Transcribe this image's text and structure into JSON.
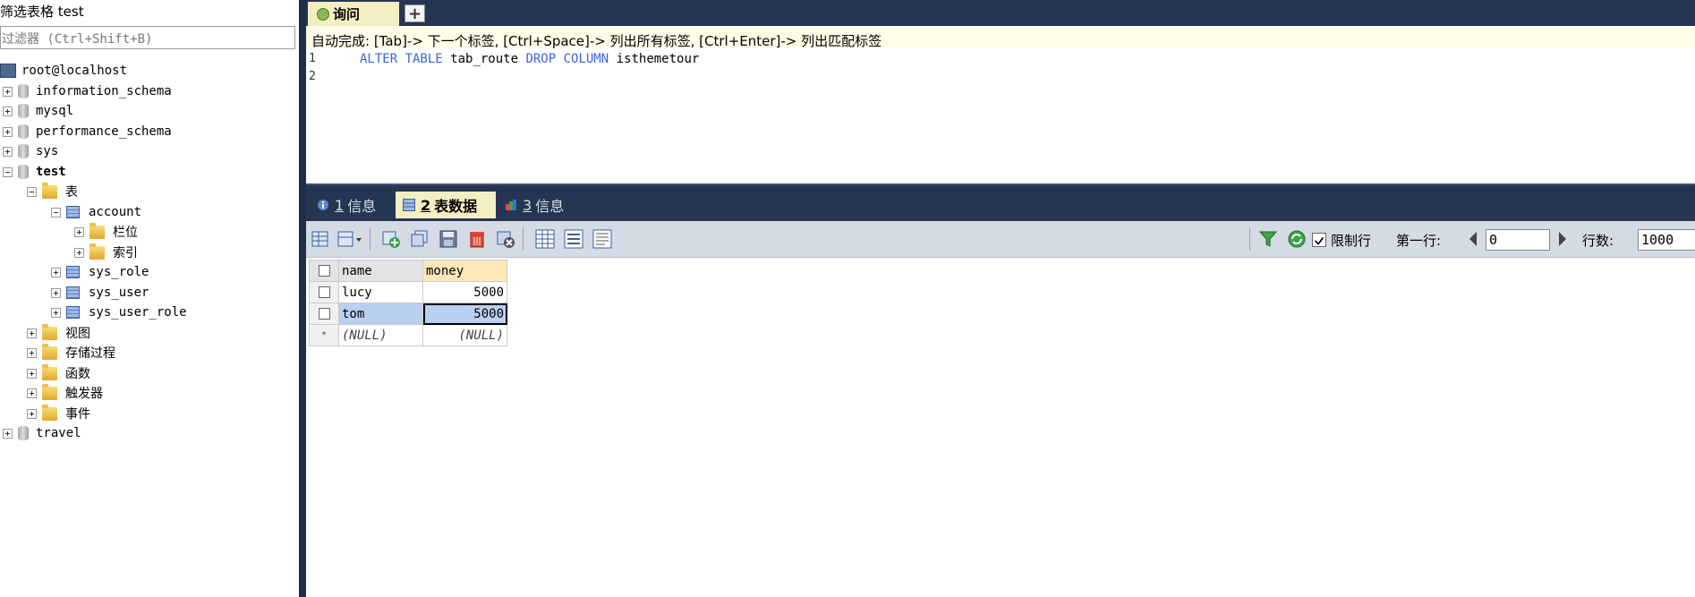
{
  "left": {
    "title": "筛选表格 test",
    "filter_placeholder": "过滤器 (Ctrl+Shift+B)",
    "tree": {
      "host": "root@localhost",
      "databases": [
        "information_schema",
        "mysql",
        "performance_schema",
        "sys"
      ],
      "active_db": "test",
      "tables_folder": "表",
      "open_table": "account",
      "open_table_children": [
        "栏位",
        "索引"
      ],
      "other_tables": [
        "sys_role",
        "sys_user",
        "sys_user_role"
      ],
      "folders": [
        "视图",
        "存储过程",
        "函数",
        "触发器",
        "事件"
      ],
      "last_db": "travel"
    }
  },
  "query_tab": {
    "label": "询问",
    "add_label": "+"
  },
  "editor": {
    "hint": "自动完成: [Tab]-> 下一个标签, [Ctrl+Space]-> 列出所有标签, [Ctrl+Enter]-> 列出匹配标签",
    "line_numbers": [
      "1",
      "2"
    ],
    "code": {
      "kw1": "ALTER TABLE",
      "table": "tab_route",
      "kw2": "DROP COLUMN",
      "column": "isthemetour"
    }
  },
  "result_tabs": [
    {
      "num": "1",
      "label": "信息"
    },
    {
      "num": "2",
      "label": "表数据"
    },
    {
      "num": "3",
      "label": "信息"
    }
  ],
  "toolbar": {
    "limit_rows_label": "限制行",
    "first_row_label": "第一行:",
    "first_row_value": "0",
    "row_count_label": "行数:",
    "row_count_value": "1000"
  },
  "grid": {
    "columns": [
      "name",
      "money"
    ],
    "rows": [
      {
        "name": "lucy",
        "money": "5000"
      },
      {
        "name": "tom",
        "money": "5000"
      }
    ],
    "new_row": {
      "marker": "*",
      "name": "(NULL)",
      "money": "(NULL)"
    }
  },
  "colors": {
    "dark_bar": "#253653",
    "active_tab": "#f4efc2",
    "keyword": "#3b64d8",
    "selection": "#b9d0ef"
  }
}
